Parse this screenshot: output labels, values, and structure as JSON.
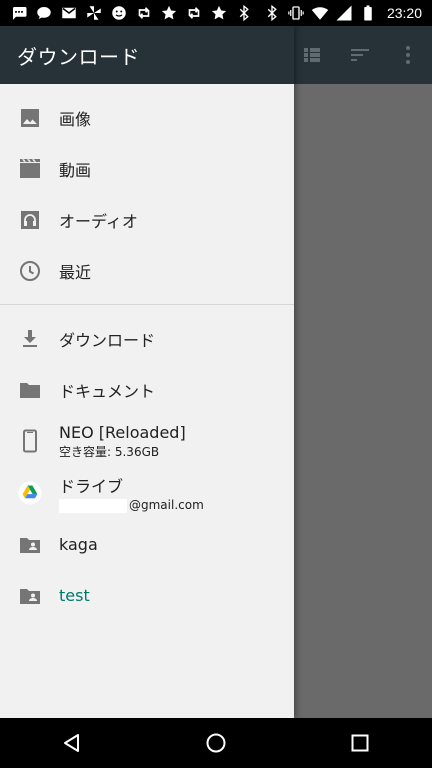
{
  "status_bar": {
    "time": "23:20",
    "left_icons": [
      "chat-icon",
      "cloud-chat-icon",
      "mail-icon",
      "pinwheel-icon",
      "face-icon",
      "retweet-icon",
      "star-icon",
      "retweet-icon",
      "star-icon",
      "bluetooth-icon"
    ],
    "right_icons": [
      "bluetooth-icon",
      "vibrate-icon",
      "wifi-icon",
      "signal-icon",
      "battery-icon"
    ]
  },
  "drawer": {
    "title": "ダウンロード",
    "items_top": [
      {
        "label": "画像",
        "icon": "image-icon"
      },
      {
        "label": "動画",
        "icon": "movie-icon"
      },
      {
        "label": "オーディオ",
        "icon": "audio-icon"
      },
      {
        "label": "最近",
        "icon": "clock-icon"
      }
    ],
    "items_bottom": [
      {
        "label": "ダウンロード",
        "icon": "download-icon"
      },
      {
        "label": "ドキュメント",
        "icon": "folder-icon"
      },
      {
        "label": "NEO [Reloaded]",
        "sub": "空き容量: 5.36GB",
        "icon": "phone-icon"
      },
      {
        "label": "ドライブ",
        "sub": "@gmail.com",
        "icon": "drive-icon"
      },
      {
        "label": "kaga",
        "icon": "shared-folder-icon"
      },
      {
        "label": "test",
        "icon": "shared-folder-icon"
      }
    ]
  },
  "colors": {
    "toolbar": "#263238",
    "drawer_bg": "#f1f1f1",
    "active_text": "#00796b",
    "icon_gray": "#757575",
    "scrim": "#6a6a6a"
  }
}
